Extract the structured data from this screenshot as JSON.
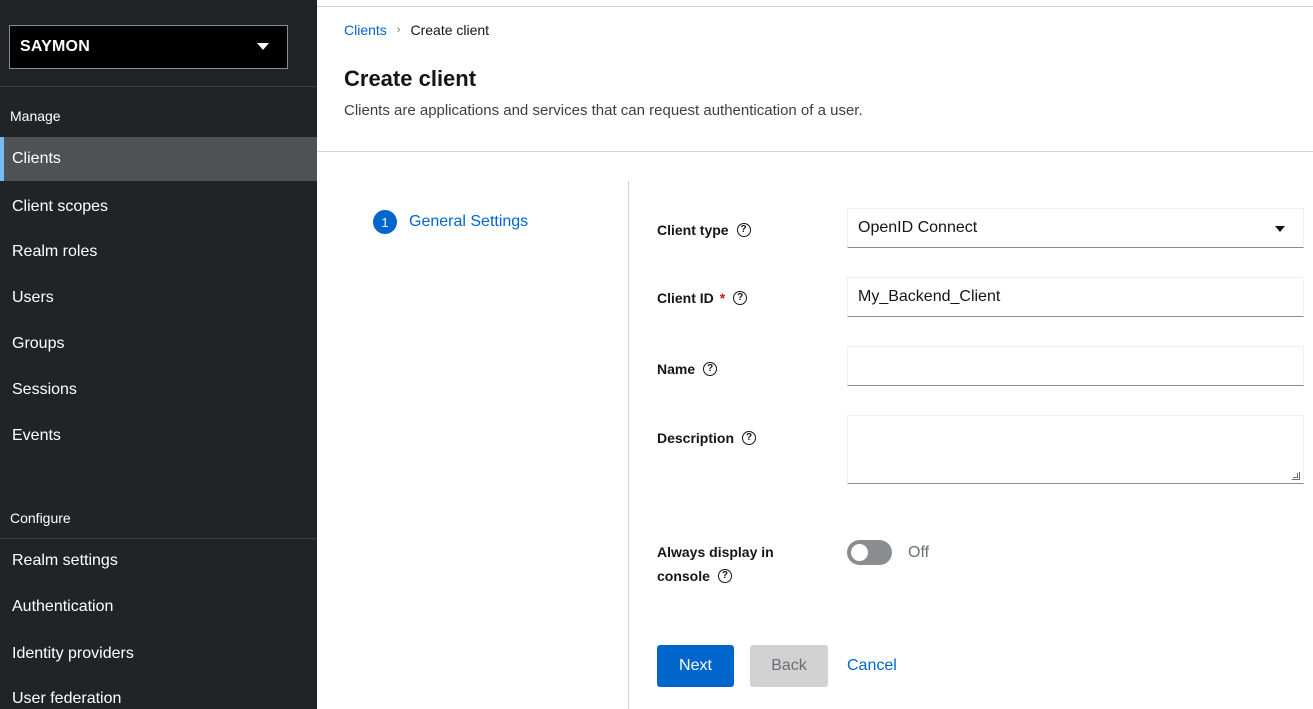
{
  "sidebar": {
    "realm": "SAYMON",
    "manage_heading": "Manage",
    "configure_heading": "Configure",
    "manage_items": [
      "Clients",
      "Client scopes",
      "Realm roles",
      "Users",
      "Groups",
      "Sessions",
      "Events"
    ],
    "configure_items": [
      "Realm settings",
      "Authentication",
      "Identity providers",
      "User federation"
    ],
    "active_item": "Clients"
  },
  "breadcrumb": {
    "parent": "Clients",
    "separator": "›",
    "current": "Create client"
  },
  "page": {
    "title": "Create client",
    "description": "Clients are applications and services that can request authentication of a user."
  },
  "wizard": {
    "step_number": "1",
    "step_label": "General Settings"
  },
  "form": {
    "client_type_label": "Client type",
    "client_type_value": "OpenID Connect",
    "client_id_label": "Client ID",
    "client_id_required": "*",
    "client_id_value": "My_Backend_Client",
    "name_label": "Name",
    "name_value": "",
    "description_label": "Description",
    "description_value": "",
    "always_display_label_line1": "Always display in",
    "always_display_label_line2": "console",
    "always_display_state": "Off",
    "help_glyph": "?"
  },
  "buttons": {
    "next": "Next",
    "back": "Back",
    "cancel": "Cancel"
  },
  "colors": {
    "sidebar_bg": "#212427",
    "active_bg": "#4f5255",
    "accent": "#0066cc"
  }
}
